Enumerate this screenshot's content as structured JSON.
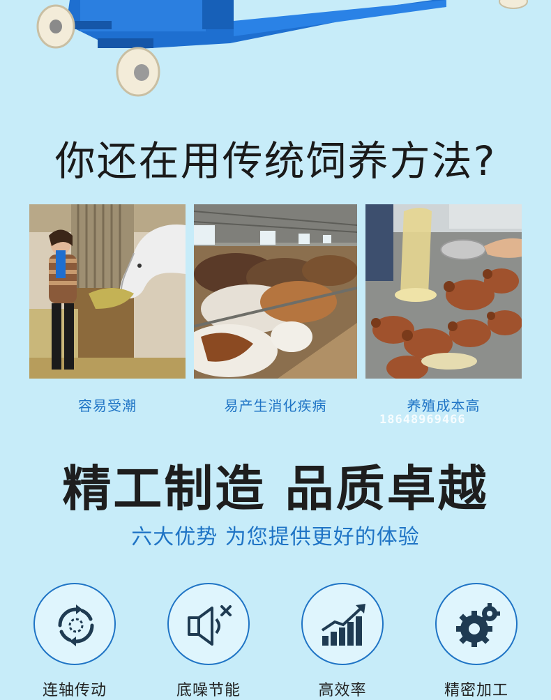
{
  "question_title": "你还在用传统饲养方法?",
  "problems": [
    {
      "caption": "容易受潮",
      "image": "woman-feeding-horse-hay"
    },
    {
      "caption": "易产生消化疾病",
      "image": "cattle-barn-feeding"
    },
    {
      "caption": "养殖成本高",
      "image": "chickens-feed-pouring"
    }
  ],
  "watermark": "18648969466",
  "main_title": "精工制造 品质卓越",
  "sub_title": "六大优势 为您提供更好的体验",
  "features": [
    {
      "label": "连轴传动",
      "icon": "rotation-icon"
    },
    {
      "label": "底噪节能",
      "icon": "speaker-mute-icon"
    },
    {
      "label": "高效率",
      "icon": "growth-chart-icon"
    },
    {
      "label": "精密加工",
      "icon": "gears-icon"
    }
  ],
  "colors": {
    "background": "#c7ecf9",
    "accent": "#1f74c5",
    "machine": "#1e6fd0"
  }
}
